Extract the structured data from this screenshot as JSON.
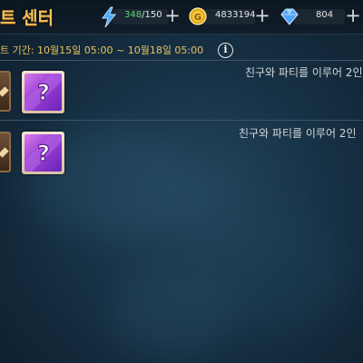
{
  "header": {
    "title": "트 센터",
    "energy": {
      "icon": "lightning-icon",
      "current": "348",
      "max": "/150"
    },
    "gold": {
      "icon": "gold-coin-icon",
      "value": "4833194"
    },
    "gems": {
      "icon": "blue-gem-icon",
      "value": "804"
    },
    "plus_label": "+"
  },
  "event": {
    "period_text": "트 기간: 10월15일 05:00 ~ 10월18일 05:00",
    "info_label": "i"
  },
  "missions": [
    {
      "text": "친구와 파티를 이루어 2인",
      "reward_icon": "purple-mystery-box-icon"
    },
    {
      "text": "친구와 파티를 이루어 2인",
      "reward_icon": "purple-mystery-box-icon"
    }
  ],
  "colors": {
    "title": "#f3c15c",
    "period": "#e9c461",
    "energy_current": "#5fd46a",
    "reward_purple": "#9b3fd6"
  }
}
